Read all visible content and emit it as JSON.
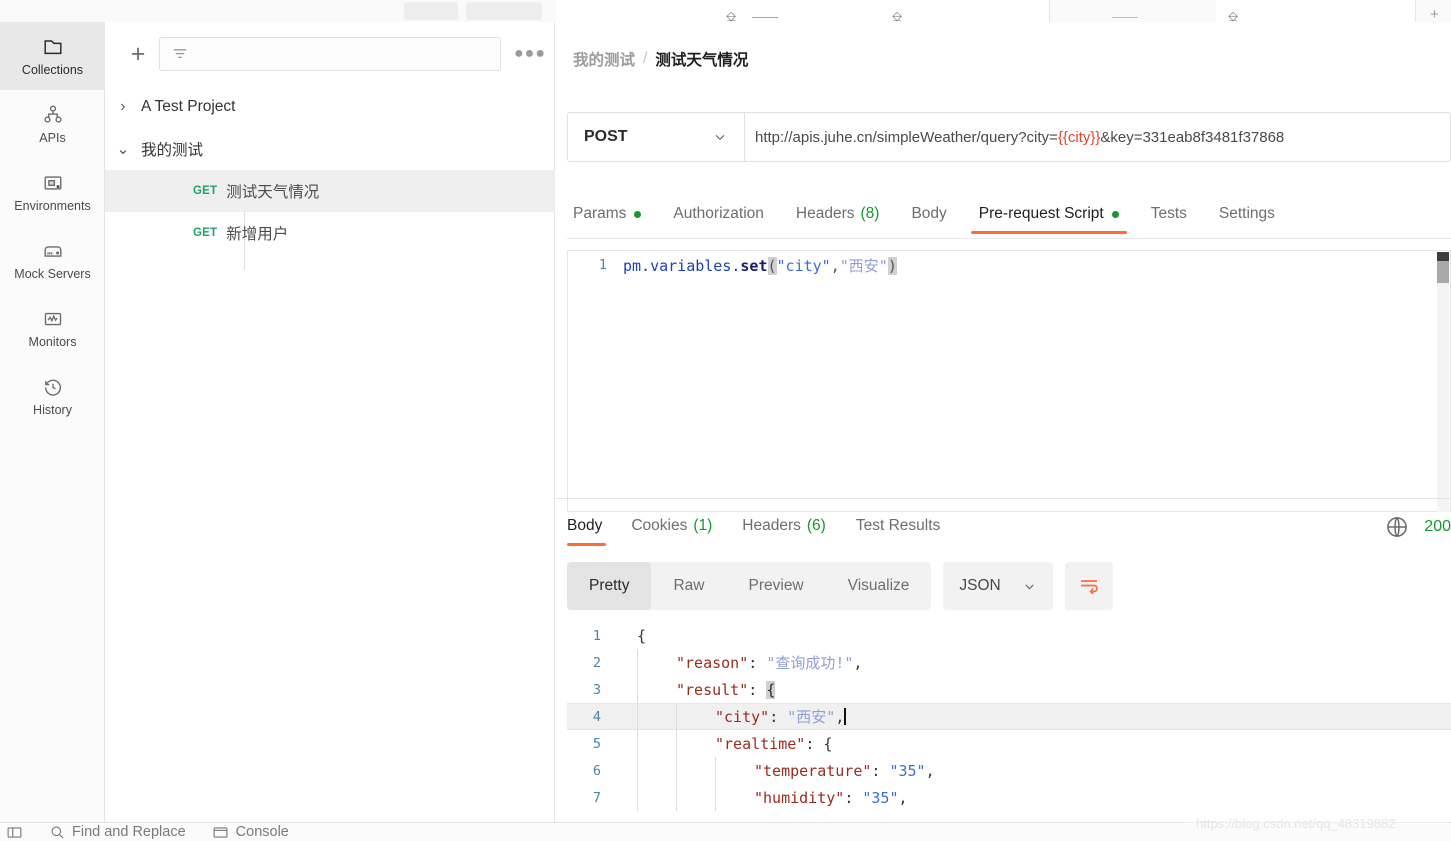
{
  "rail": {
    "items": [
      {
        "label": "Collections",
        "icon": "collections-icon",
        "active": true
      },
      {
        "label": "APIs",
        "icon": "apis-icon",
        "active": false
      },
      {
        "label": "Environments",
        "icon": "environments-icon",
        "active": false
      },
      {
        "label": "Mock Servers",
        "icon": "mock-servers-icon",
        "active": false
      },
      {
        "label": "Monitors",
        "icon": "monitors-icon",
        "active": false
      },
      {
        "label": "History",
        "icon": "history-icon",
        "active": false
      }
    ]
  },
  "collections": {
    "new_label": "+",
    "filter_placeholder": "",
    "more_label": "●●●",
    "tree": [
      {
        "type": "folder",
        "label": "A Test Project",
        "expanded": false,
        "twisty": "›"
      },
      {
        "type": "folder",
        "label": "我的测试",
        "expanded": true,
        "twisty": "⌄"
      },
      {
        "type": "request",
        "method": "GET",
        "label": "测试天气情况",
        "selected": true
      },
      {
        "type": "request",
        "method": "GET",
        "label": "新增用户",
        "selected": false
      }
    ]
  },
  "request": {
    "breadcrumb": {
      "parent": "我的测试",
      "separator": "/",
      "current": "测试天气情况"
    },
    "method": "POST",
    "url_prefix": "http://apis.juhe.cn/simpleWeather/query?city=",
    "url_variable": "{{city}}",
    "url_suffix": "&key=331eab8f3481f37868",
    "tabs": [
      {
        "label": "Params",
        "dot": true,
        "count": "",
        "active": false
      },
      {
        "label": "Authorization",
        "dot": false,
        "count": "",
        "active": false
      },
      {
        "label": "Headers",
        "dot": false,
        "count": "(8)",
        "active": false
      },
      {
        "label": "Body",
        "dot": false,
        "count": "",
        "active": false
      },
      {
        "label": "Pre-request Script",
        "dot": true,
        "count": "",
        "active": true
      },
      {
        "label": "Tests",
        "dot": false,
        "count": "",
        "active": false
      },
      {
        "label": "Settings",
        "dot": false,
        "count": "",
        "active": false
      }
    ],
    "script": {
      "line_number": "1",
      "object": "pm.variables.",
      "func": "set",
      "open_paren": "(",
      "arg1": "\"city\"",
      "comma": ",",
      "arg2": "\"西安\"",
      "close_paren": ")"
    }
  },
  "response": {
    "tabs": [
      {
        "label": "Body",
        "count": "",
        "active": true
      },
      {
        "label": "Cookies",
        "count": "(1)",
        "active": false
      },
      {
        "label": "Headers",
        "count": "(6)",
        "active": false
      },
      {
        "label": "Test Results",
        "count": "",
        "active": false
      }
    ],
    "status_code": "200",
    "globe_icon": "globe-icon",
    "format_tabs": [
      {
        "label": "Pretty",
        "active": true
      },
      {
        "label": "Raw",
        "active": false
      },
      {
        "label": "Preview",
        "active": false
      },
      {
        "label": "Visualize",
        "active": false
      }
    ],
    "language": "JSON",
    "wrap_icon": "wrap-lines-icon",
    "body_lines": [
      {
        "n": "1",
        "indent": 0,
        "parts": [
          {
            "t": "{",
            "c": "j-punct"
          }
        ],
        "active": false
      },
      {
        "n": "2",
        "indent": 1,
        "parts": [
          {
            "t": "\"reason\"",
            "c": "j-key"
          },
          {
            "t": ": ",
            "c": "j-punct"
          },
          {
            "t": "\"查询成功!\"",
            "c": "j-str-cjk"
          },
          {
            "t": ",",
            "c": "j-punct"
          }
        ],
        "active": false
      },
      {
        "n": "3",
        "indent": 1,
        "parts": [
          {
            "t": "\"result\"",
            "c": "j-key"
          },
          {
            "t": ": ",
            "c": "j-punct"
          },
          {
            "t": "{",
            "c": "brace-hl"
          }
        ],
        "active": false
      },
      {
        "n": "4",
        "indent": 2,
        "parts": [
          {
            "t": "\"city\"",
            "c": "j-key"
          },
          {
            "t": ": ",
            "c": "j-punct"
          },
          {
            "t": "\"西安\"",
            "c": "j-str-cjk"
          },
          {
            "t": ",",
            "c": "j-punct"
          }
        ],
        "active": true,
        "caret": true
      },
      {
        "n": "5",
        "indent": 2,
        "parts": [
          {
            "t": "\"realtime\"",
            "c": "j-key"
          },
          {
            "t": ": ",
            "c": "j-punct"
          },
          {
            "t": "{",
            "c": "j-punct"
          }
        ],
        "active": false
      },
      {
        "n": "6",
        "indent": 3,
        "parts": [
          {
            "t": "\"temperature\"",
            "c": "j-key"
          },
          {
            "t": ": ",
            "c": "j-punct"
          },
          {
            "t": "\"35\"",
            "c": "j-str"
          },
          {
            "t": ",",
            "c": "j-punct"
          }
        ],
        "active": false
      },
      {
        "n": "7",
        "indent": 3,
        "parts": [
          {
            "t": "\"humidity\"",
            "c": "j-key"
          },
          {
            "t": ": ",
            "c": "j-punct"
          },
          {
            "t": "\"35\"",
            "c": "j-str"
          },
          {
            "t": ",",
            "c": "j-punct"
          }
        ],
        "active": false
      }
    ]
  },
  "statusbar": {
    "items": [
      {
        "label": "",
        "icon": "sidebar-toggle-icon"
      },
      {
        "label": "Find and Replace",
        "icon": "search-icon"
      },
      {
        "label": "Console",
        "icon": "console-icon"
      }
    ]
  },
  "watermark": "https://blog.csdn.net/qq_48319882",
  "colors": {
    "accent": "#ff6c37",
    "success": "#15992c",
    "variable": "#e8432b",
    "json_key": "#9c2b1e",
    "json_string": "#3b6fd4"
  }
}
